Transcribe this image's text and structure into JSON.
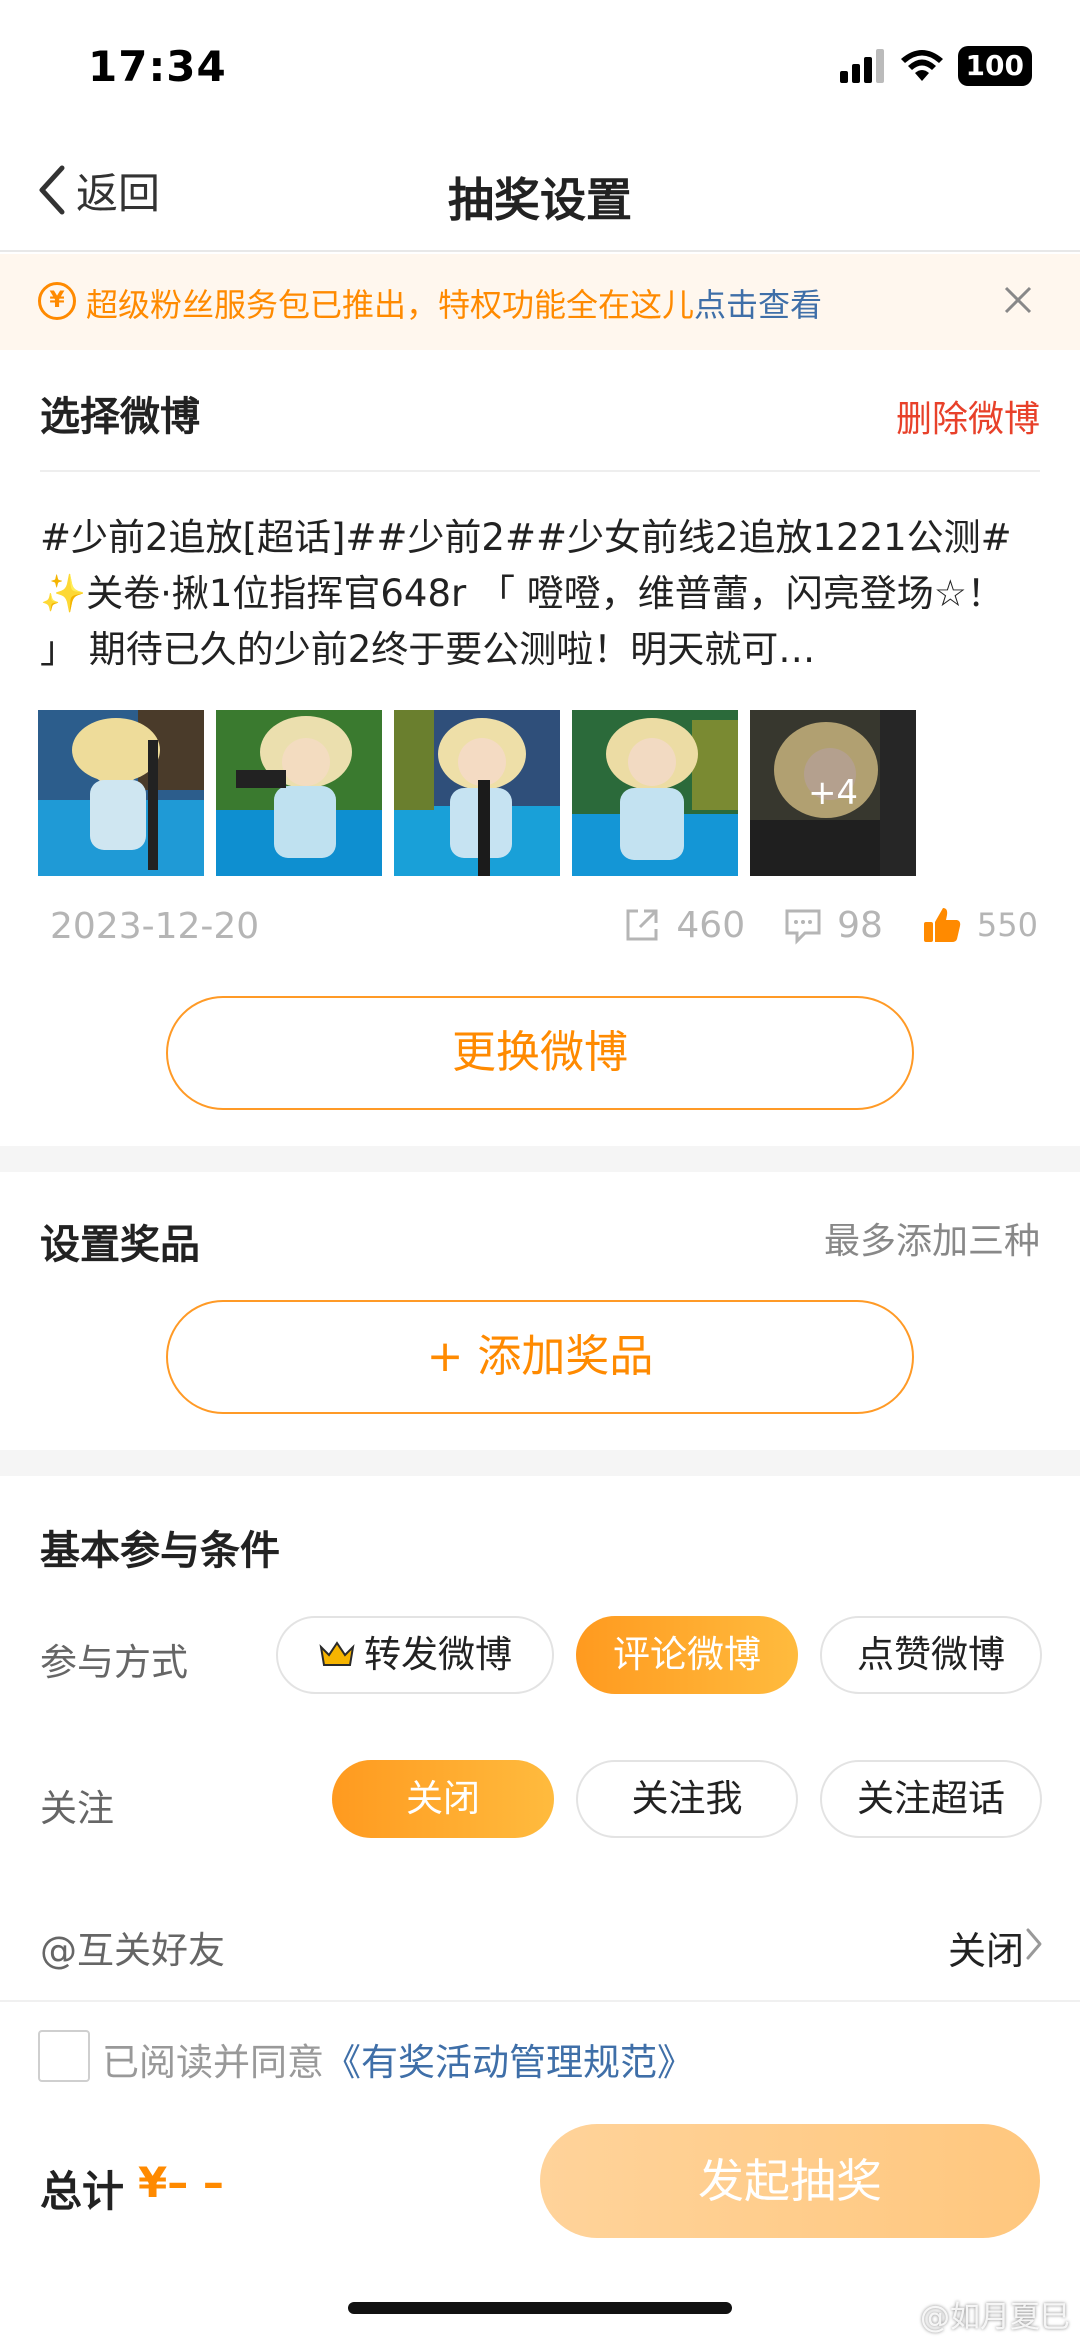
{
  "status_bar": {
    "time": "17:34",
    "battery": "100"
  },
  "nav": {
    "back_label": "返回",
    "title": "抽奖设置"
  },
  "notice": {
    "icon": "¥",
    "text": "超级粉丝服务包已推出，特权功能全在这儿",
    "link": "点击查看"
  },
  "select_weibo": {
    "title": "选择微博",
    "delete_label": "删除微博",
    "post_text": "#少前2追放[超话]##少前2##少女前线2追放1221公测# ✨关卷·揪1位指挥官648r 「 噔噔，维普蕾，闪亮登场☆！ 」 期待已久的少前2终于要公测啦！明天就可…",
    "more_images": "+4",
    "date": "2023-12-20",
    "reposts": "460",
    "comments": "98",
    "likes": "550",
    "change_label": "更换微博"
  },
  "prizes": {
    "title": "设置奖品",
    "hint": "最多添加三种",
    "add_label": "+  添加奖品"
  },
  "conditions": {
    "title": "基本参与条件",
    "method_label": "参与方式",
    "methods": [
      "转发微博",
      "评论微博",
      "点赞微博"
    ],
    "follow_label": "关注",
    "follow_options": [
      "关闭",
      "关注我",
      "关注超话"
    ],
    "mutual_label": "@互关好友",
    "mutual_value": "关闭"
  },
  "footer": {
    "agree_prefix": "已阅读并同意",
    "agree_link": "《有奖活动管理规范》",
    "total_label": "总计",
    "total_value": "¥– –",
    "submit_label": "发起抽奖",
    "watermark": "@如月夏巳"
  },
  "colors": {
    "accent": "#ff8a00",
    "link": "#3f6fa8",
    "delete": "#e8412a",
    "submit_disabled": "#ffd39a"
  }
}
